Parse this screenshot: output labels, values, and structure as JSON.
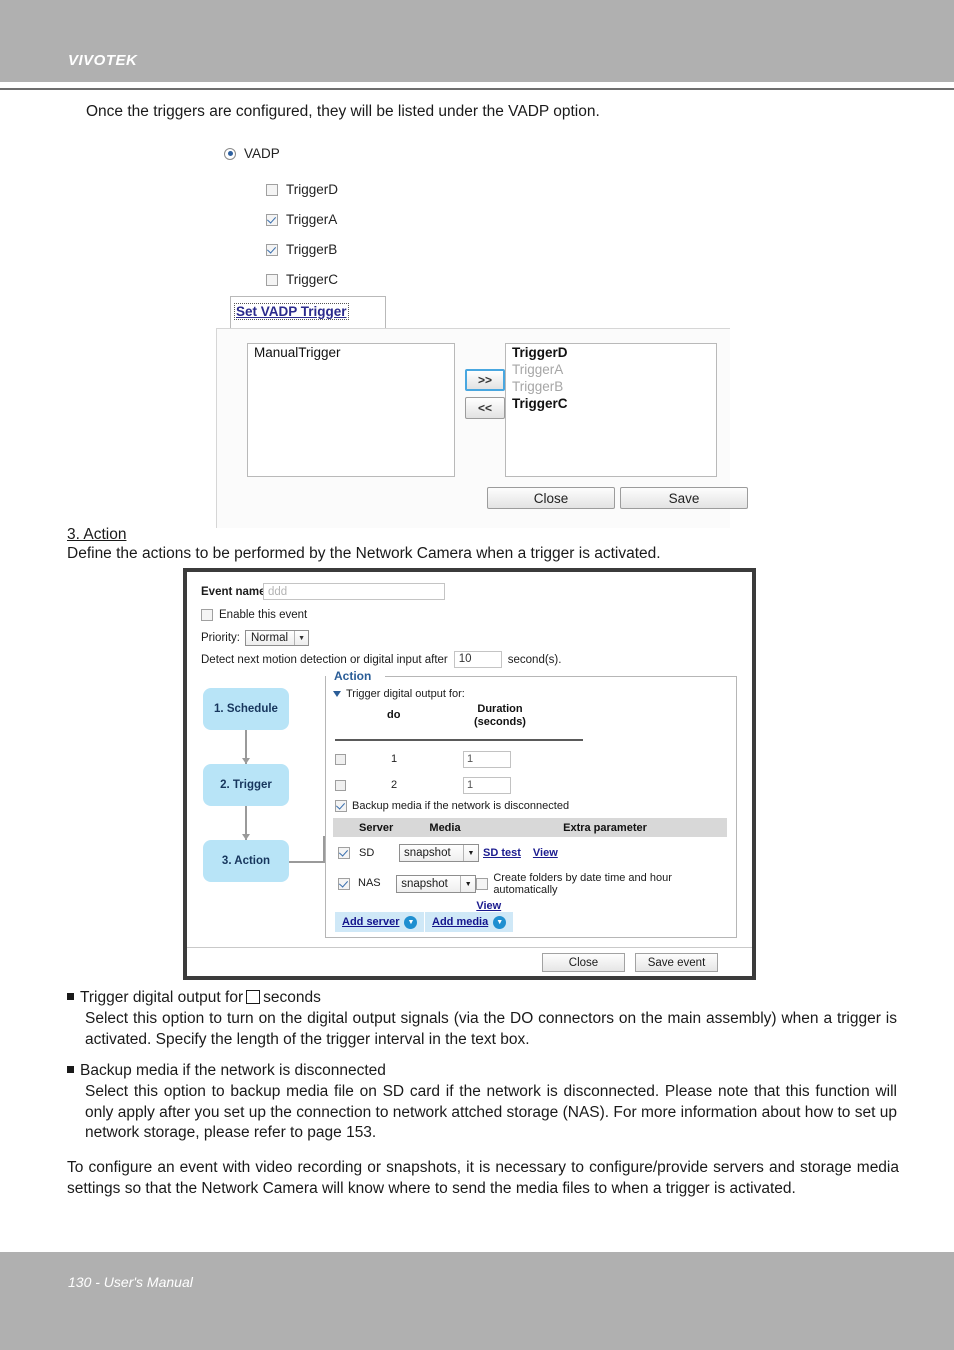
{
  "header": {
    "brand": "VIVOTEK"
  },
  "footer": {
    "page_label": "130 - User's Manual"
  },
  "intro": {
    "line": "Once the triggers are configured, they will be listed under the VADP option."
  },
  "vadp_panel": {
    "option_label": "VADP",
    "triggers": [
      {
        "label": "TriggerD",
        "checked": false
      },
      {
        "label": "TriggerA",
        "checked": true
      },
      {
        "label": "TriggerB",
        "checked": true
      },
      {
        "label": "TriggerC",
        "checked": false
      }
    ],
    "tab_label": "Set VADP Trigger",
    "available_list": [
      "ManualTrigger"
    ],
    "selected_list": [
      {
        "label": "TriggerD",
        "state": "bold"
      },
      {
        "label": "TriggerA",
        "state": "dim"
      },
      {
        "label": "TriggerB",
        "state": "dim"
      },
      {
        "label": "TriggerC",
        "state": "bold"
      }
    ],
    "move_right_label": ">>",
    "move_left_label": "<<",
    "close_label": "Close",
    "save_label": "Save"
  },
  "section": {
    "heading": "3. Action",
    "description": "Define the actions to be performed by the Network Camera when a trigger is activated."
  },
  "action_dialog": {
    "event_name_label": "Event name:",
    "event_name_value": "ddd",
    "enable_label": "Enable this event",
    "enable_checked": false,
    "priority_label": "Priority:",
    "priority_value": "Normal",
    "detect_label_pre": "Detect next motion detection or digital input after",
    "detect_value": "10",
    "detect_label_post": "second(s).",
    "flow_steps": [
      "1. Schedule",
      "2. Trigger",
      "3. Action"
    ],
    "fieldset_legend": "Action",
    "trigger_do_label": "Trigger digital output for:",
    "do_table": {
      "col_do": "do",
      "col_duration_line1": "Duration",
      "col_duration_line2": "(seconds)",
      "rows": [
        {
          "checked": false,
          "do": "1",
          "duration": "1"
        },
        {
          "checked": false,
          "do": "2",
          "duration": "1"
        }
      ]
    },
    "backup_label": "Backup media if the network is disconnected",
    "backup_checked": true,
    "server_table": {
      "headers": [
        "",
        "Server",
        "Media",
        "Extra parameter"
      ],
      "rows": [
        {
          "checked": true,
          "server": "SD",
          "media": "snapshot",
          "links": [
            "SD test",
            "View"
          ],
          "extra_checkbox": null
        },
        {
          "checked": true,
          "server": "NAS",
          "media": "snapshot",
          "links": [
            "View"
          ],
          "extra_checkbox": "Create folders by date time and hour automatically",
          "extra_checked": false
        }
      ]
    },
    "add_server_label": "Add server",
    "add_media_label": "Add media",
    "close_label": "Close",
    "save_event_label": "Save event"
  },
  "notes": [
    {
      "head_pre": "Trigger digital output for",
      "head_post": "seconds",
      "body": "Select this option to turn on the digital output signals (via the DO connectors on the main assembly) when a trigger is activated. Specify the length of the trigger interval in the text box."
    },
    {
      "head_pre": "Backup media if the network is disconnected",
      "head_post": "",
      "body": "Select this option to backup media file on SD card if the network is disconnected. Please note that this function will only apply after you set up the connection to network attched storage (NAS). For more information about how to set up network storage, please refer to page 153."
    }
  ],
  "closing": "To configure an event with video recording or snapshots, it is necessary to configure/provide servers and storage media settings so that the Network Camera will know where to send the media files to when a trigger is activated.",
  "colors": {
    "band_gray": "#b0b0b0",
    "flow_step_blue": "#b8e4f7",
    "legend_blue": "#2a5d97",
    "link_blue": "#1b1b8f",
    "add_button_blue": "#cfe8f7"
  }
}
